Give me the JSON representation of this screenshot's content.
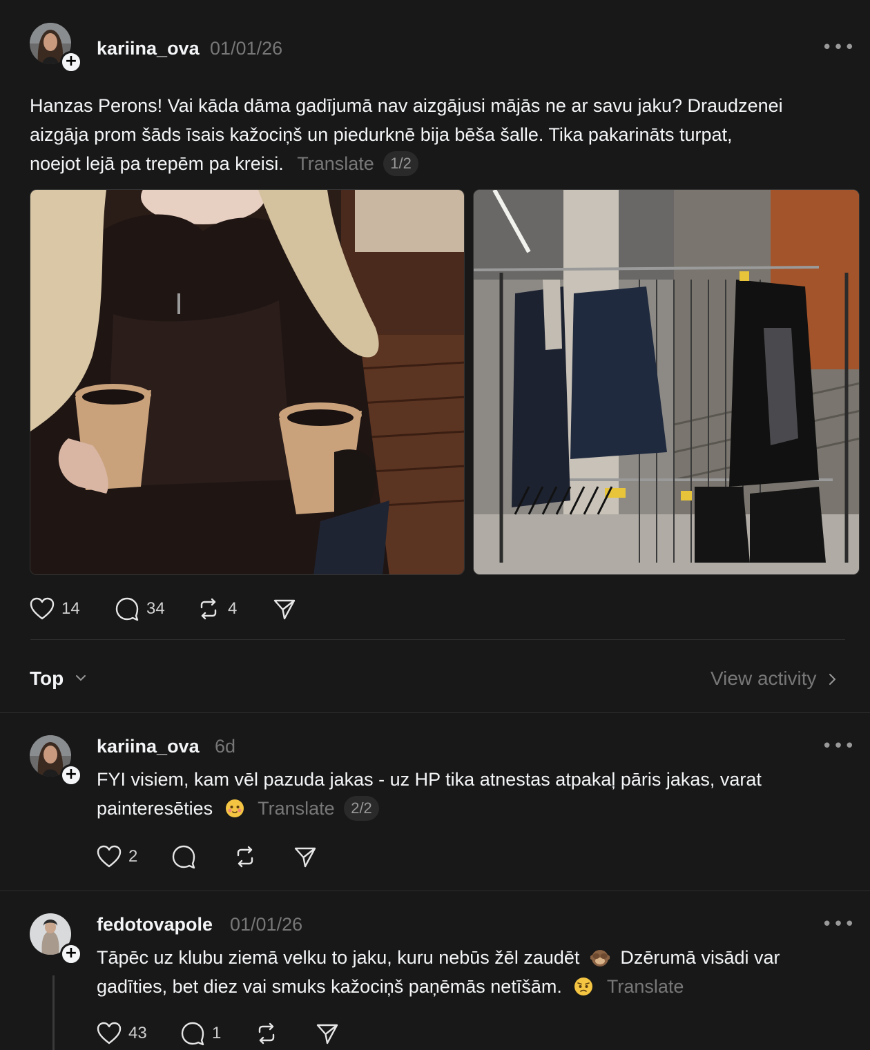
{
  "main_post": {
    "username": "kariina_ova",
    "timestamp": "01/01/26",
    "more_label": "•••",
    "text_lines": [
      "Hanzas Perons! Vai kāda dāma gadījumā nav aizgājusi mājās ne ar savu jaku? Draudzenei",
      "aizgāja prom šāds īsais kažociņš un piedurknē bija bēša šalle. Tika pakarināts turpat,",
      "noejot lejā pa trepēm pa kreisi."
    ],
    "translate_label": "Translate",
    "page_indicator": "1/2",
    "likes": "14",
    "replies": "34",
    "reposts": "4"
  },
  "sort": {
    "label": "Top",
    "view_activity": "View activity"
  },
  "reply1": {
    "username": "kariina_ova",
    "timestamp": "6d",
    "more_label": "•••",
    "text_lines": [
      "FYI visiem, kam vēl pazuda jakas - uz HP tika atnestas atpakaļ pāris jakas, varat",
      "painteresēties"
    ],
    "translate_label": "Translate",
    "page_indicator": "2/2",
    "likes": "2"
  },
  "reply2": {
    "username": "fedotovapole",
    "timestamp": "01/01/26",
    "more_label": "•••",
    "text_lines": [
      "Tāpēc uz klubu ziemā velku to jaku, kuru nebūs žēl zaudēt",
      "Dzērumā visādi var",
      "gadīties, bet diez vai smuks kažociņš paņēmās netīšām."
    ],
    "translate_label": "Translate",
    "likes": "43",
    "replies": "1"
  },
  "icons": {
    "like": "heart-icon",
    "reply": "comment-icon",
    "repost": "repost-icon",
    "share": "send-icon",
    "chevron": "chevron-down-icon",
    "arrow": "chevron-right-icon"
  },
  "colors": {
    "background": "#181818",
    "text": "#f3f5f7",
    "secondary": "#777777",
    "divider": "#2f2f2f"
  }
}
